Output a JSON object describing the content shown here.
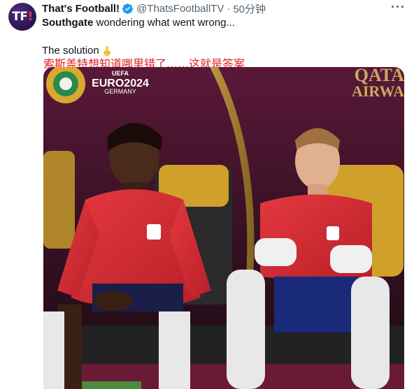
{
  "avatar": {
    "initials": "TF",
    "accent": "!"
  },
  "tweet": {
    "display_name": "That's Football!",
    "handle": "@ThatsFootballTV",
    "separator": "·",
    "time": "50分钟",
    "more": "···",
    "text_bold": "Southgate",
    "text_rest": " wondering what went wrong...",
    "text_line2": "The solution",
    "emoji_icon": "pointing-down-emoji",
    "caption": "索斯盖特想知道哪里错了……这就是答案"
  },
  "image": {
    "logo_top": "UEFA",
    "logo_main": "EURO2024",
    "logo_sub": "GERMANY",
    "sponsor_line1": "QATA",
    "sponsor_line2": "AIRWA"
  },
  "colors": {
    "brand_purple": "#2a1450",
    "verified_blue": "#1d9bf0",
    "caption_red": "#e02020",
    "jersey_red": "#d92c35"
  }
}
